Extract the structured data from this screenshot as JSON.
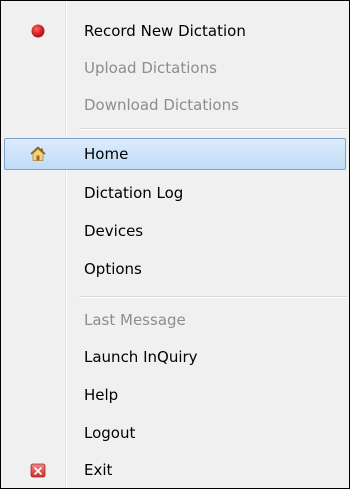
{
  "menu": {
    "items": [
      {
        "label": "Record New Dictation",
        "enabled": true,
        "icon": "record-icon"
      },
      {
        "label": "Upload Dictations",
        "enabled": false
      },
      {
        "label": "Download Dictations",
        "enabled": false
      },
      {
        "label": "Home",
        "enabled": true,
        "icon": "home-icon",
        "highlighted": true
      },
      {
        "label": "Dictation Log",
        "enabled": true
      },
      {
        "label": "Devices",
        "enabled": true
      },
      {
        "label": "Options",
        "enabled": true
      },
      {
        "label": "Last Message",
        "enabled": false
      },
      {
        "label": "Launch InQuiry",
        "enabled": true
      },
      {
        "label": "Help",
        "enabled": true
      },
      {
        "label": "Logout",
        "enabled": true
      },
      {
        "label": "Exit",
        "enabled": true,
        "icon": "exit-icon"
      }
    ]
  },
  "colors": {
    "record_icon": "#d42525",
    "exit_icon": "#d9534f",
    "highlight": "#c1dcf8",
    "disabled_text": "#8d8d8d"
  }
}
